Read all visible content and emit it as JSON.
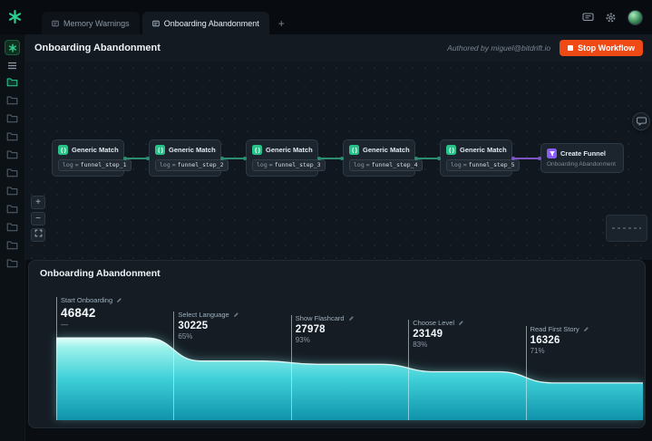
{
  "topbar": {
    "tabs": [
      {
        "label": "Memory Warnings"
      },
      {
        "label": "Onboarding Abandonment"
      }
    ],
    "new_tab": "+"
  },
  "workflow_header": {
    "title": "Onboarding Abandonment",
    "authored_by": "Authored by miguel@bitdrift.io",
    "stop_button_label": "Stop Workflow"
  },
  "canvas": {
    "nodes": [
      {
        "title": "Generic Match",
        "param_key": "log",
        "op": "=",
        "param_value": "funnel_step_1"
      },
      {
        "title": "Generic Match",
        "param_key": "log",
        "op": "=",
        "param_value": "funnel_step_2"
      },
      {
        "title": "Generic Match",
        "param_key": "log",
        "op": "=",
        "param_value": "funnel_step_3"
      },
      {
        "title": "Generic Match",
        "param_key": "log",
        "op": "=",
        "param_value": "funnel_step_4"
      },
      {
        "title": "Generic Match",
        "param_key": "log",
        "op": "=",
        "param_value": "funnel_step_5"
      }
    ],
    "create_node": {
      "title": "Create Funnel",
      "subtitle": "Onboarding Abandonment"
    },
    "zoom_in": "+",
    "zoom_out": "−"
  },
  "funnel_panel": {
    "title": "Onboarding Abandonment",
    "stages": [
      {
        "name": "Start Onboarding",
        "value": "46842",
        "sub": "—"
      },
      {
        "name": "Select Language",
        "value": "30225",
        "sub": "65%"
      },
      {
        "name": "Show Flashcard",
        "value": "27978",
        "sub": "93%"
      },
      {
        "name": "Choose Level",
        "value": "23149",
        "sub": "83%"
      },
      {
        "name": "Read First Story",
        "value": "16326",
        "sub": "71%"
      }
    ]
  },
  "chart_data": {
    "type": "area",
    "subtype": "funnel",
    "title": "Onboarding Abandonment",
    "categories": [
      "Start Onboarding",
      "Select Language",
      "Show Flashcard",
      "Choose Level",
      "Read First Story"
    ],
    "values": [
      46842,
      30225,
      27978,
      23149,
      16326
    ],
    "step_conversion_pct": [
      null,
      65,
      93,
      83,
      71
    ],
    "legend": "none",
    "grid": "stage dividers only",
    "colors": {
      "area_top": "#dffdf9",
      "area_mid": "#3ecfd8",
      "area_bottom": "#0f93ab"
    }
  },
  "colors": {
    "accent_green": "#27c287",
    "accent_purple": "#8b5cf6",
    "stop_red": "#ef4a15",
    "edge_green": "#2b8e72",
    "edge_purple": "#7d55c7"
  },
  "sidebar": {
    "folder_count": 11
  }
}
